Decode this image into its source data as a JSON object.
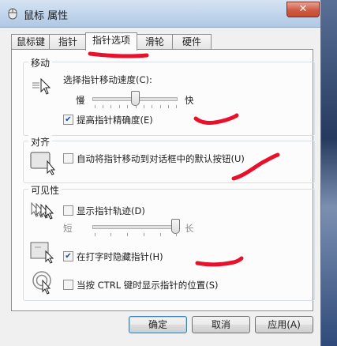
{
  "window": {
    "title": "鼠标 属性",
    "close_label": "✕"
  },
  "tabs": [
    {
      "label": "鼠标键",
      "active": false
    },
    {
      "label": "指针",
      "active": false
    },
    {
      "label": "指针选项",
      "active": true
    },
    {
      "label": "滑轮",
      "active": false
    },
    {
      "label": "硬件",
      "active": false
    }
  ],
  "motion": {
    "title": "移动",
    "speed_label": "选择指针移动速度(C):",
    "slow": "慢",
    "fast": "快",
    "speed_level": 0.5,
    "precision_label": "提高指针精确度(E)",
    "precision_checked": true
  },
  "snap": {
    "title": "对齐",
    "snap_label": "自动将指针移动到对话框中的默认按钮(U)",
    "snap_checked": false
  },
  "visibility": {
    "title": "可见性",
    "trails_label": "显示指针轨迹(D)",
    "trails_checked": false,
    "short": "短",
    "long": "长",
    "trail_level": 1.0,
    "hide_label": "在打字时隐藏指针(H)",
    "hide_checked": true,
    "ctrl_label": "当按 CTRL 键时显示指针的位置(S)",
    "ctrl_checked": false
  },
  "buttons": {
    "ok": "确定",
    "cancel": "取消",
    "apply": "应用(A)"
  },
  "colors": {
    "scribble": "#e8102a",
    "check": "#1b4aa8"
  }
}
